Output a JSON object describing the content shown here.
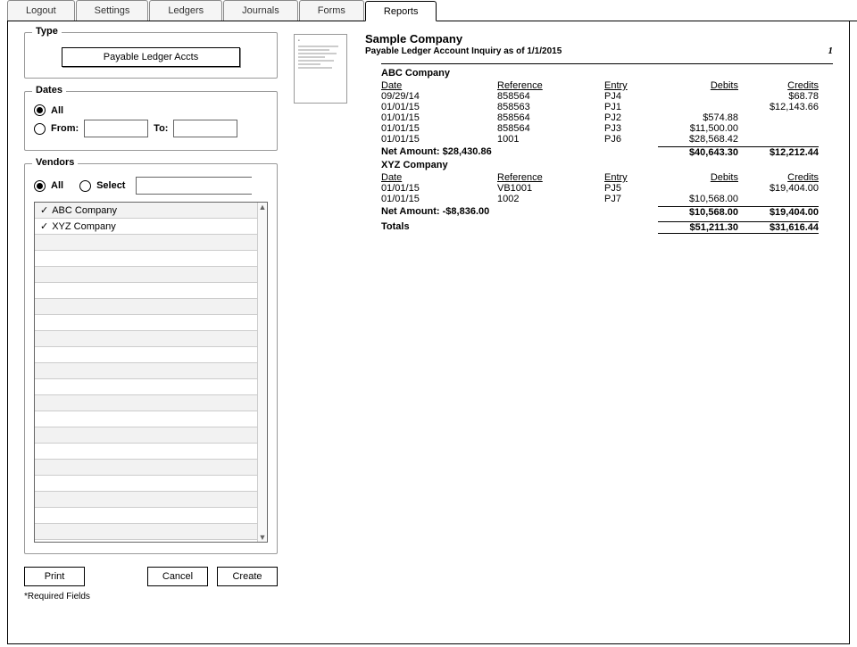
{
  "tabs": {
    "items": [
      {
        "label": "Logout"
      },
      {
        "label": "Settings"
      },
      {
        "label": "Ledgers"
      },
      {
        "label": "Journals"
      },
      {
        "label": "Forms"
      },
      {
        "label": "Reports"
      }
    ],
    "active_index": 5
  },
  "type_group": {
    "title": "Type",
    "button_label": "Payable Ledger Accts"
  },
  "dates_group": {
    "title": "Dates",
    "all_label": "All",
    "from_label": "From:",
    "to_label": "To:",
    "selected": "all",
    "from_value": "",
    "to_value": ""
  },
  "vendors_group": {
    "title": "Vendors",
    "all_label": "All",
    "select_label": "Select",
    "selected_mode": "all",
    "search_value": "",
    "list": [
      {
        "checked": true,
        "name": "ABC Company"
      },
      {
        "checked": true,
        "name": "XYZ Company"
      }
    ],
    "empty_rows": 20
  },
  "actions": {
    "print": "Print",
    "cancel": "Cancel",
    "create": "Create"
  },
  "footnote": "*Required Fields",
  "report": {
    "company": "Sample Company",
    "subtitle": "Payable Ledger Account Inquiry as of  1/1/2015",
    "page": "1",
    "headers": {
      "date": "Date",
      "reference": "Reference",
      "entry": "Entry",
      "debits": "Debits",
      "credits": "Credits"
    },
    "sections": [
      {
        "name": "ABC Company",
        "rows": [
          {
            "date": "09/29/14",
            "ref": "858564",
            "entry": "PJ4",
            "deb": "",
            "cred": "$68.78"
          },
          {
            "date": "01/01/15",
            "ref": "858563",
            "entry": "PJ1",
            "deb": "",
            "cred": "$12,143.66"
          },
          {
            "date": "01/01/15",
            "ref": "858564",
            "entry": "PJ2",
            "deb": "$574.88",
            "cred": ""
          },
          {
            "date": "01/01/15",
            "ref": "858564",
            "entry": "PJ3",
            "deb": "$11,500.00",
            "cred": ""
          },
          {
            "date": "01/01/15",
            "ref": "1001",
            "entry": "PJ6",
            "deb": "$28,568.42",
            "cred": ""
          }
        ],
        "net_label": "Net Amount:  $28,430.86",
        "net_deb": "$40,643.30",
        "net_cred": "$12,212.44"
      },
      {
        "name": "XYZ Company",
        "rows": [
          {
            "date": "01/01/15",
            "ref": "VB1001",
            "entry": "PJ5",
            "deb": "",
            "cred": "$19,404.00"
          },
          {
            "date": "01/01/15",
            "ref": "1002",
            "entry": "PJ7",
            "deb": "$10,568.00",
            "cred": ""
          }
        ],
        "net_label": "Net Amount:  -$8,836.00",
        "net_deb": "$10,568.00",
        "net_cred": "$19,404.00"
      }
    ],
    "totals": {
      "label": "Totals",
      "deb": "$51,211.30",
      "cred": "$31,616.44"
    }
  }
}
